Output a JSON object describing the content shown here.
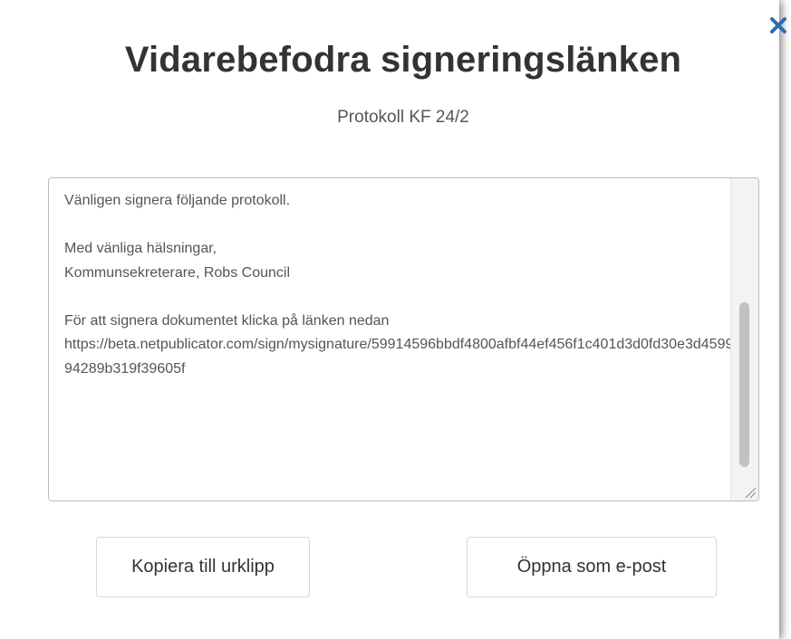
{
  "dialog": {
    "title": "Vidarebefodra signeringslänken",
    "subtitle": "Protokoll KF 24/2",
    "close_icon": "close-icon",
    "accent_color": "#2a6db5"
  },
  "message": {
    "text": "Vänligen signera följande protokoll.\n\nMed vänliga hälsningar,\nKommunsekreterare, Robs Council\n\nFör att signera dokumentet klicka på länken nedan\nhttps://beta.netpublicator.com/sign/mysignature/59914596bbdf4800afbf44ef456f1c401d3d0fd30e3d459994289b319f39605f"
  },
  "buttons": {
    "copy_label": "Kopiera till urklipp",
    "email_label": "Öppna som e-post"
  }
}
